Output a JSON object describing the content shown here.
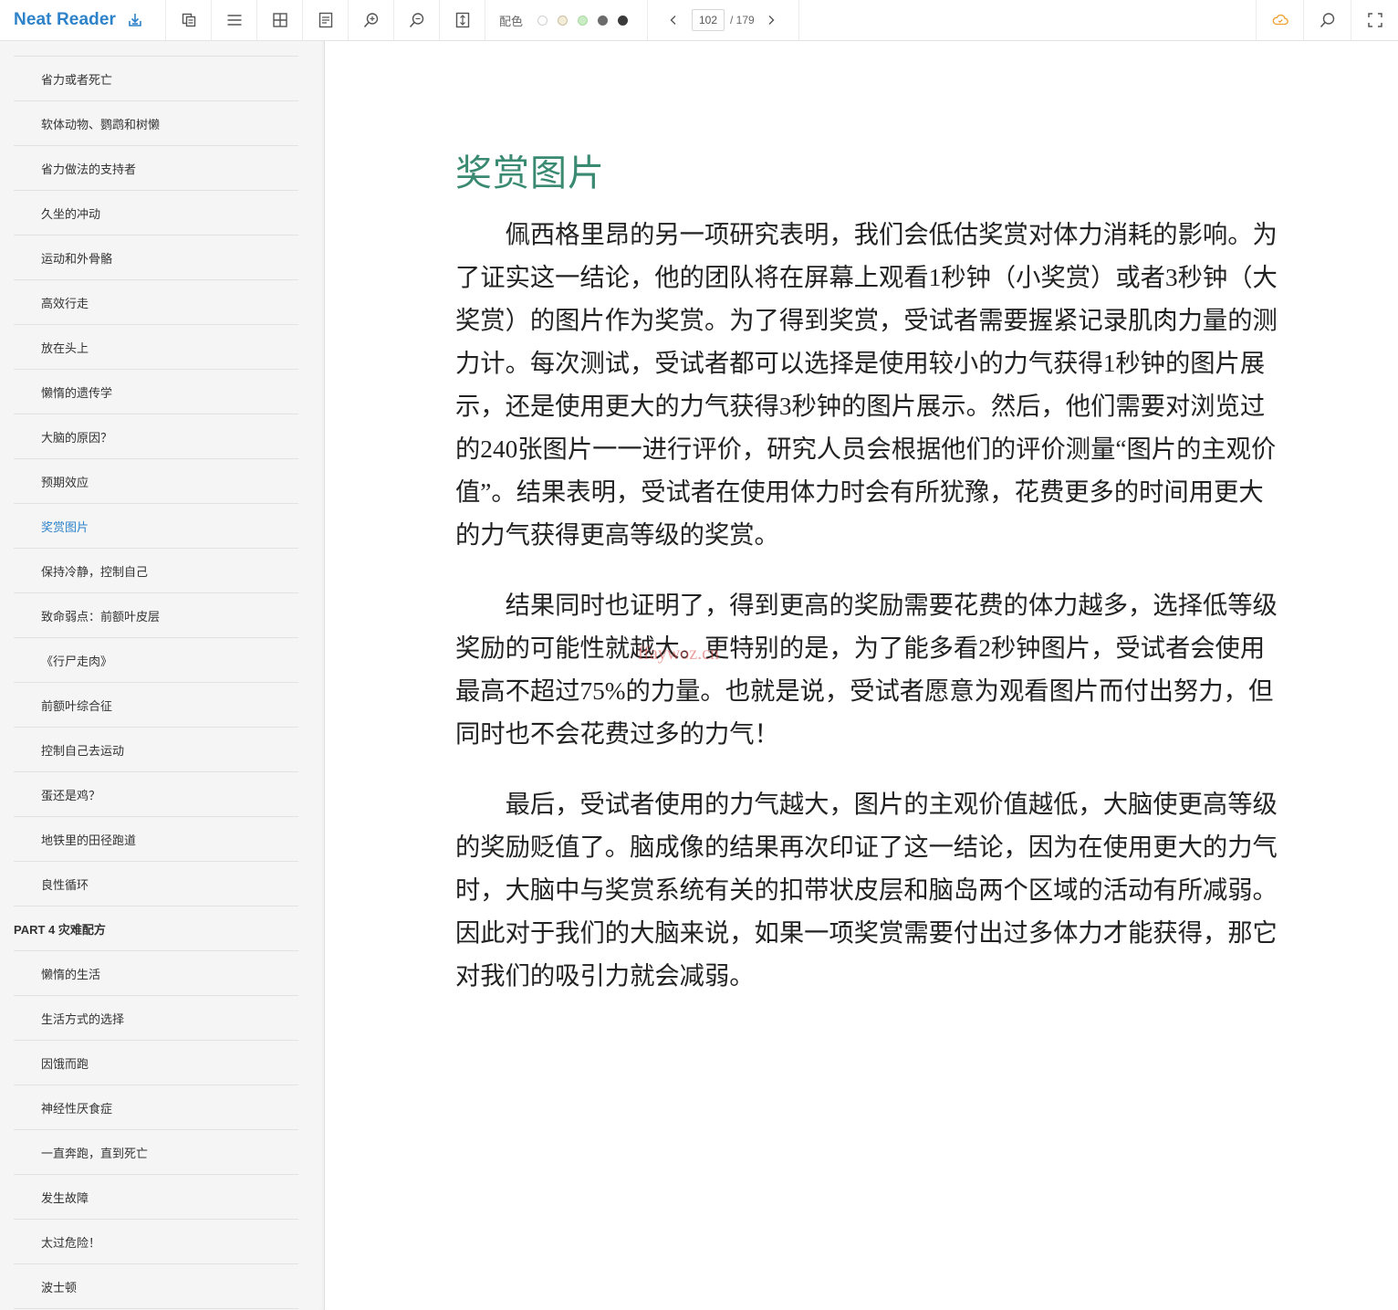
{
  "app": {
    "name": "Neat Reader"
  },
  "toolbar": {
    "color_label": "配色",
    "swatches": [
      "#ffffff",
      "#f3ecd9",
      "#c9ecc4",
      "#6b6b6b",
      "#3a3a3a"
    ],
    "page_current": "102",
    "page_total": "/ 179",
    "accent_color": "#2d82c9",
    "cloud_icon_color": "#f0a030"
  },
  "sidebar": {
    "items": [
      {
        "label": "省力或者死亡"
      },
      {
        "label": "软体动物、鹦鹉和树懒"
      },
      {
        "label": "省力做法的支持者"
      },
      {
        "label": "久坐的冲动"
      },
      {
        "label": "运动和外骨骼"
      },
      {
        "label": "高效行走"
      },
      {
        "label": "放在头上"
      },
      {
        "label": "懒惰的遗传学"
      },
      {
        "label": "大脑的原因？"
      },
      {
        "label": "预期效应"
      },
      {
        "label": "奖赏图片"
      },
      {
        "label": "保持冷静，控制自己"
      },
      {
        "label": "致命弱点：前额叶皮层"
      },
      {
        "label": "《行尸走肉》"
      },
      {
        "label": "前额叶综合征"
      },
      {
        "label": "控制自己去运动"
      },
      {
        "label": "蛋还是鸡？"
      },
      {
        "label": "地铁里的田径跑道"
      },
      {
        "label": "良性循环"
      },
      {
        "label": "PART 4 灾难配方"
      },
      {
        "label": "懒惰的生活"
      },
      {
        "label": "生活方式的选择"
      },
      {
        "label": "因饿而跑"
      },
      {
        "label": "神经性厌食症"
      },
      {
        "label": "一直奔跑，直到死亡"
      },
      {
        "label": "发生故障"
      },
      {
        "label": "太过危险！"
      },
      {
        "label": "波士顿"
      }
    ],
    "active_index": 10
  },
  "content": {
    "title": "奖赏图片",
    "paragraphs": [
      "佩西格里昂的另一项研究表明，我们会低估奖赏对体力消耗的影响。为了证实这一结论，他的团队将在屏幕上观看1秒钟（小奖赏）或者3秒钟（大奖赏）的图片作为奖赏。为了得到奖赏，受试者需要握紧记录肌肉力量的测力计。每次测试，受试者都可以选择是使用较小的力气获得1秒钟的图片展示，还是使用更大的力气获得3秒钟的图片展示。然后，他们需要对浏览过的240张图片一一进行评价，研究人员会根据他们的评价测量“图片的主观价值”。结果表明，受试者在使用体力时会有所犹豫，花费更多的时间用更大的力气获得更高等级的奖赏。",
      "结果同时也证明了，得到更高的奖励需要花费的体力越多，选择低等级奖励的可能性就越大。更特别的是，为了能多看2秒钟图片，受试者会使用最高不超过75%的力量。也就是说，受试者愿意为观看图片而付出努力，但同时也不会花费过多的力气！",
      "最后，受试者使用的力气越大，图片的主观价值越低，大脑使更高等级的奖励贬值了。脑成像的结果再次印证了这一结论，因为在使用更大的力气时，大脑中与奖赏系统有关的扣带状皮层和脑岛两个区域的活动有所减弱。因此对于我们的大脑来说，如果一项奖赏需要付出过多体力才能获得，那它对我们的吸引力就会减弱。"
    ],
    "watermark": "ffaywoz.cn"
  }
}
